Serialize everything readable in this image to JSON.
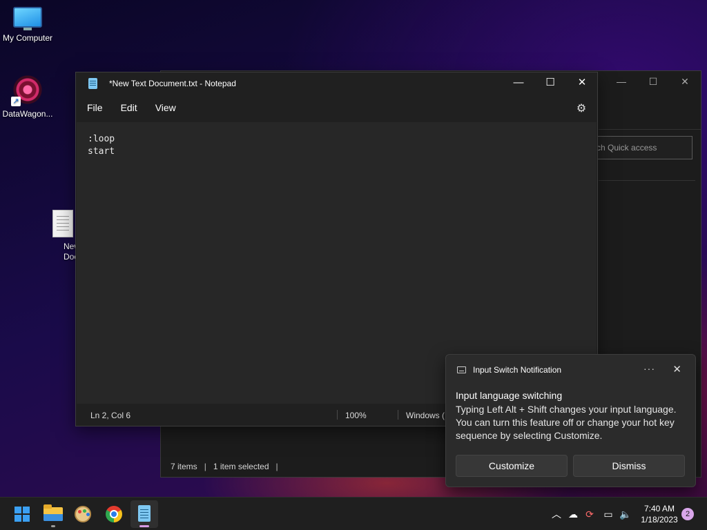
{
  "desktop": {
    "icons": [
      {
        "label": "My Computer",
        "icon": "monitor-icon"
      },
      {
        "label": "DataWagon...",
        "icon": "datawagon-icon"
      },
      {
        "label": "New\nDocu",
        "icon": "text-file-icon"
      }
    ]
  },
  "explorer": {
    "search_placeholder": "ch Quick access",
    "status": {
      "items": "7 items",
      "selected": "1 item selected",
      "sep": "|"
    },
    "controls": {
      "minimize": "—",
      "maximize": "☐",
      "close": "✕"
    }
  },
  "notepad": {
    "title": "*New Text Document.txt - Notepad",
    "controls": {
      "minimize": "—",
      "maximize": "☐",
      "close": "✕"
    },
    "menu": [
      "File",
      "Edit",
      "View"
    ],
    "settings_icon": "⚙",
    "content": ":loop\nstart",
    "status": {
      "position": "Ln 2, Col 6",
      "zoom": "100%",
      "line_ending": "Windows ("
    }
  },
  "toast": {
    "app_name": "Input Switch Notification",
    "more": "···",
    "close": "✕",
    "title": "Input language switching",
    "body": "Typing Left Alt + Shift changes your input language. You can turn this feature off or change your hot key sequence by selecting Customize.",
    "buttons": {
      "customize": "Customize",
      "dismiss": "Dismiss"
    }
  },
  "taskbar": {
    "apps": [
      "start",
      "file-explorer",
      "paint",
      "chrome",
      "notepad"
    ],
    "tray": {
      "chevron": "︿",
      "network": "☁",
      "sync": "⟳",
      "display": "▭",
      "volume": "🔈"
    },
    "time": "7:40 AM",
    "date": "1/18/2023",
    "notification_count": "2"
  },
  "colors": {
    "accent": "#3ba0f3",
    "active_indicator": "#d79be6",
    "badge": "#d9a6ea"
  }
}
